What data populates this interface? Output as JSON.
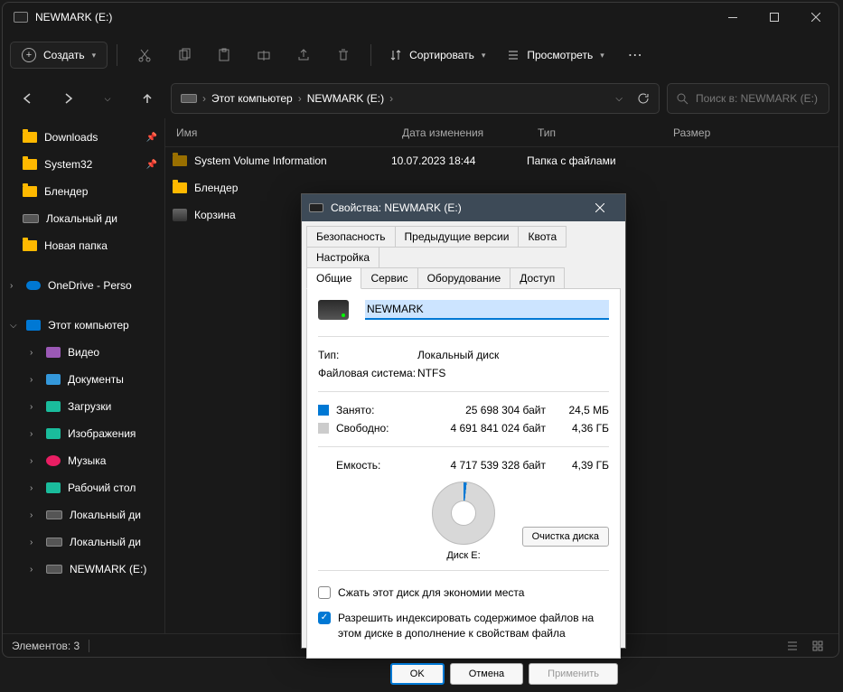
{
  "window": {
    "title": "NEWMARK (E:)"
  },
  "toolbar": {
    "new": "Создать",
    "sort": "Сортировать",
    "view": "Просмотреть"
  },
  "breadcrumb": {
    "root": "Этот компьютер",
    "current": "NEWMARK (E:)"
  },
  "search": {
    "placeholder": "Поиск в: NEWMARK (E:)"
  },
  "columns": {
    "name": "Имя",
    "date": "Дата изменения",
    "type": "Тип",
    "size": "Размер"
  },
  "sidebar": {
    "quick": [
      {
        "label": "Downloads",
        "pinned": true
      },
      {
        "label": "System32",
        "pinned": true
      },
      {
        "label": "Блендер"
      },
      {
        "label": "Локальный ди"
      },
      {
        "label": "Новая папка"
      }
    ],
    "onedrive": "OneDrive - Perso",
    "pc": "Этот компьютер",
    "pc_children": [
      {
        "label": "Видео",
        "icon": "purple"
      },
      {
        "label": "Документы",
        "icon": "blue"
      },
      {
        "label": "Загрузки",
        "icon": "teal"
      },
      {
        "label": "Изображения",
        "icon": "teal"
      },
      {
        "label": "Музыка",
        "icon": "pink"
      },
      {
        "label": "Рабочий стол",
        "icon": "teal"
      },
      {
        "label": "Локальный ди",
        "icon": "drive"
      },
      {
        "label": "Локальный ди",
        "icon": "drive"
      },
      {
        "label": "NEWMARK (E:)",
        "icon": "drive"
      }
    ]
  },
  "files": [
    {
      "name": "System Volume Information",
      "date": "10.07.2023 18:44",
      "type": "Папка с файлами",
      "icon": "folder-dim"
    },
    {
      "name": "Блендер",
      "date": "",
      "type": "",
      "icon": "folder"
    },
    {
      "name": "Корзина",
      "date": "",
      "type": "",
      "icon": "bin"
    }
  ],
  "status": {
    "count": "Элементов: 3"
  },
  "props": {
    "title": "Свойства: NEWMARK (E:)",
    "tabs_row1": [
      "Безопасность",
      "Предыдущие версии",
      "Квота",
      "Настройка"
    ],
    "tabs_row2": [
      "Общие",
      "Сервис",
      "Оборудование",
      "Доступ"
    ],
    "active_tab": "Общие",
    "name_value": "NEWMARK",
    "type_label": "Тип:",
    "type_value": "Локальный диск",
    "fs_label": "Файловая система:",
    "fs_value": "NTFS",
    "used_label": "Занято:",
    "used_bytes": "25 698 304 байт",
    "used_human": "24,5 МБ",
    "free_label": "Свободно:",
    "free_bytes": "4 691 841 024 байт",
    "free_human": "4,36 ГБ",
    "cap_label": "Емкость:",
    "cap_bytes": "4 717 539 328 байт",
    "cap_human": "4,39 ГБ",
    "disk_label": "Диск E:",
    "cleanup": "Очистка диска",
    "compress": "Сжать этот диск для экономии места",
    "index": "Разрешить индексировать содержимое файлов на этом диске в дополнение к свойствам файла",
    "ok": "OK",
    "cancel": "Отмена",
    "apply": "Применить"
  }
}
